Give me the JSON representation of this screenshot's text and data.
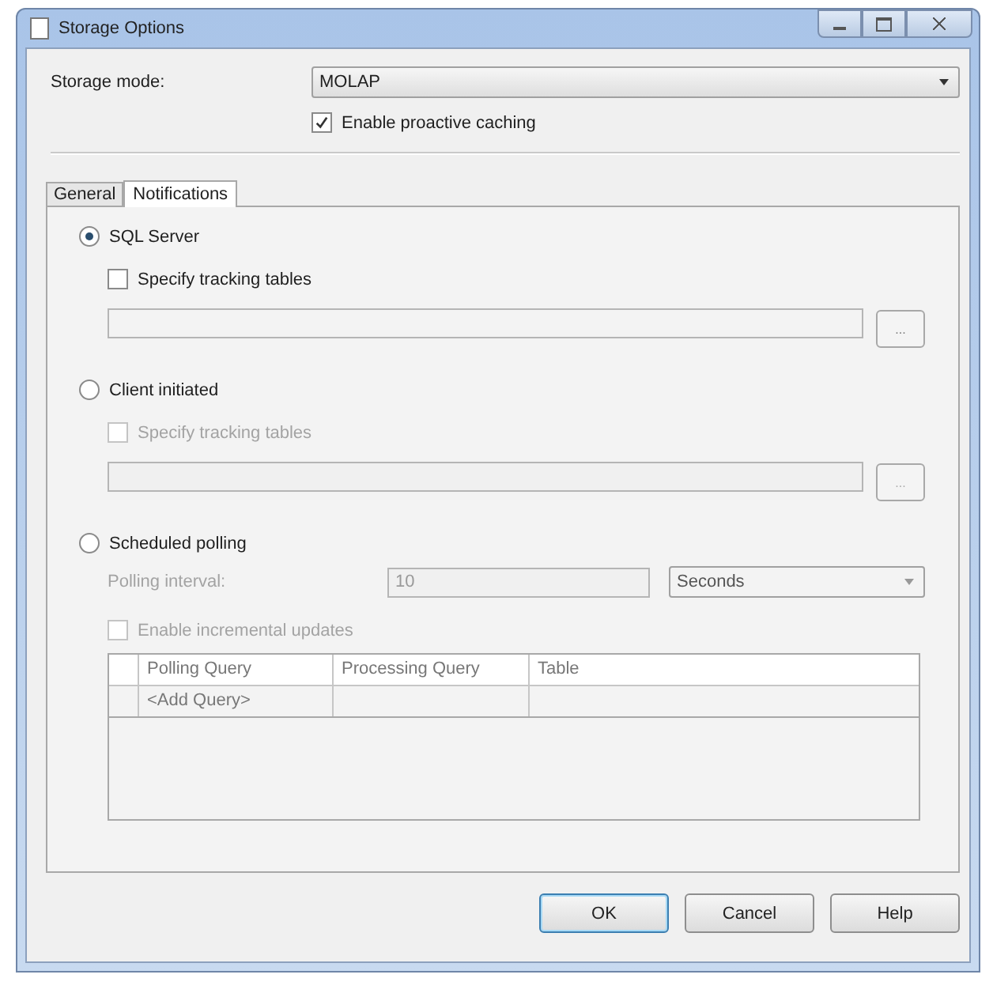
{
  "window": {
    "title": "Storage Options"
  },
  "storage_mode": {
    "label": "Storage mode:",
    "value": "MOLAP"
  },
  "proactive_caching": {
    "label": "Enable proactive caching",
    "checked": true
  },
  "tabs": [
    {
      "label": "General",
      "selected": false
    },
    {
      "label": "Notifications",
      "selected": true
    }
  ],
  "notification_options": [
    {
      "kind": "tracking",
      "label": "SQL Server",
      "selected": true,
      "tracking": {
        "label": "Specify tracking tables",
        "checked": false,
        "disabled": false
      },
      "browse": "..."
    },
    {
      "kind": "tracking",
      "label": "Client initiated",
      "selected": false,
      "tracking": {
        "label": "Specify tracking tables",
        "checked": false,
        "disabled": true
      },
      "browse": "..."
    },
    {
      "kind": "polling",
      "label": "Scheduled polling",
      "selected": false,
      "disabled": true,
      "interval_label": "Polling interval:",
      "interval": "10",
      "unit": "Seconds",
      "incremental": {
        "label": "Enable incremental updates",
        "checked": false
      },
      "grid": {
        "columns": [
          "Polling Query",
          "Processing Query",
          "Table"
        ],
        "rows": [
          [
            "<Add Query>"
          ]
        ]
      }
    }
  ],
  "buttons": [
    {
      "label": "OK",
      "default": true
    },
    {
      "label": "Cancel",
      "default": false
    },
    {
      "label": "Help",
      "default": false
    }
  ]
}
